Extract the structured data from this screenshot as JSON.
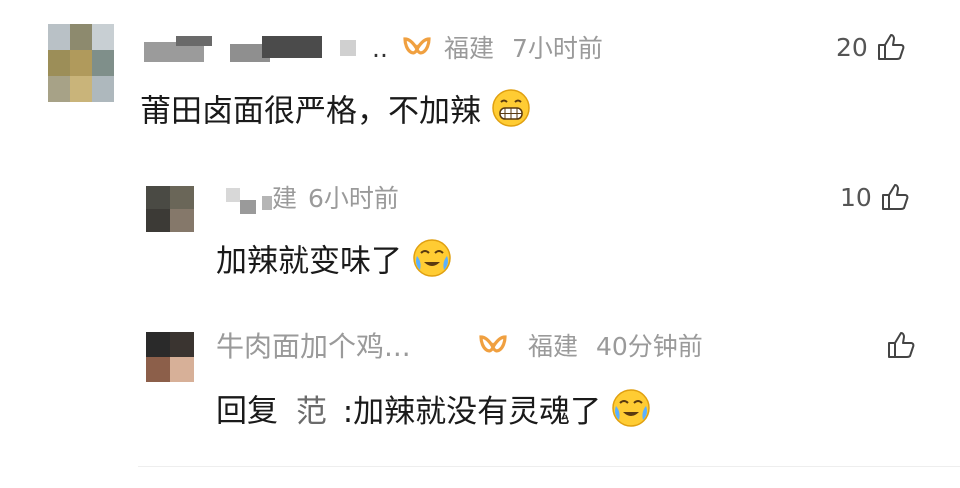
{
  "comments": [
    {
      "location": "福建",
      "time": "7小时前",
      "name_suffix": "..",
      "text": "莆田卤面很严格，不加辣",
      "likes": "20",
      "emoji_icon": "grinning-face-icon",
      "badge_icon": "vip-badge-icon"
    }
  ],
  "replies": [
    {
      "location_partial": "建",
      "time": "6小时前",
      "text": "加辣就变味了",
      "likes": "10",
      "emoji_icon": "crying-face-icon"
    },
    {
      "name": "牛肉面加个鸡...",
      "location": "福建",
      "time": "40分钟前",
      "reply_prefix": "回复",
      "reply_target": "范",
      "reply_text": ":加辣就没有灵魂了",
      "likes": "",
      "emoji_icon": "crying-face-icon",
      "badge_icon": "vip-badge-icon"
    }
  ],
  "colors": {
    "meta_text": "#9a9a9a",
    "badge": "#f0a040",
    "body_text": "#1a1a1a"
  }
}
